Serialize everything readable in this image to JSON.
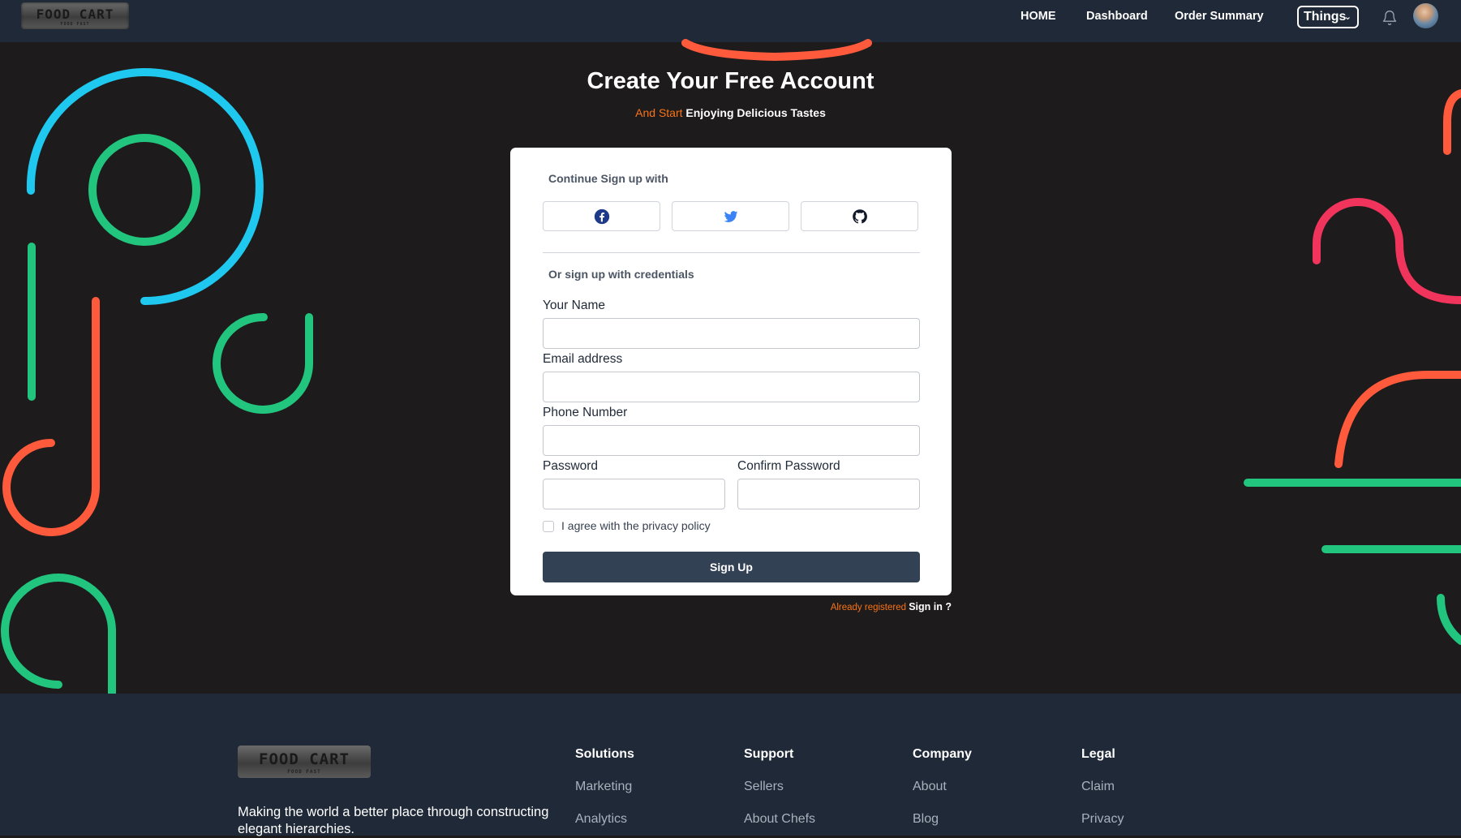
{
  "brand": {
    "logo_text": "FOOD CART",
    "logo_sub": "FOOD FAST"
  },
  "nav": {
    "links": [
      "HOME",
      "Dashboard",
      "Order Summary"
    ],
    "dropdown_label": "Things"
  },
  "hero": {
    "title": "Create Your Free Account",
    "subtitle_prefix": "And Start",
    "subtitle_rest": "Enjoying Delicious Tastes"
  },
  "form": {
    "social_heading": "Continue Sign up with",
    "social_buttons": [
      "facebook-icon",
      "twitter-icon",
      "github-icon"
    ],
    "credentials_heading": "Or sign up with credentials",
    "fields": {
      "name_label": "Your Name",
      "email_label": "Email address",
      "phone_label": "Phone Number",
      "password_label": "Password",
      "confirm_label": "Confirm Password"
    },
    "values": {
      "name": "",
      "email": "",
      "phone": "",
      "password": "",
      "confirm": ""
    },
    "privacy_label": "I agree with the privacy policy",
    "privacy_checked": false,
    "submit_label": "Sign Up"
  },
  "signin": {
    "prefix": "Already registered",
    "link": "Sign in ?"
  },
  "footer": {
    "tagline": "Making the world a better place through constructing elegant hierarchies.",
    "columns": [
      {
        "title": "Solutions",
        "links": [
          "Marketing",
          "Analytics"
        ]
      },
      {
        "title": "Support",
        "links": [
          "Sellers",
          "About Chefs"
        ]
      },
      {
        "title": "Company",
        "links": [
          "About",
          "Blog"
        ]
      },
      {
        "title": "Legal",
        "links": [
          "Claim",
          "Privacy"
        ]
      }
    ]
  },
  "colors": {
    "nav_bg": "#1f2937",
    "page_bg": "#1d1b1b",
    "accent_orange": "#f97316",
    "button_dark": "#334155",
    "deco_blue": "#1ec8ee",
    "deco_green": "#22c57e",
    "deco_coral": "#ff5a3c",
    "deco_pink": "#f0345c"
  }
}
